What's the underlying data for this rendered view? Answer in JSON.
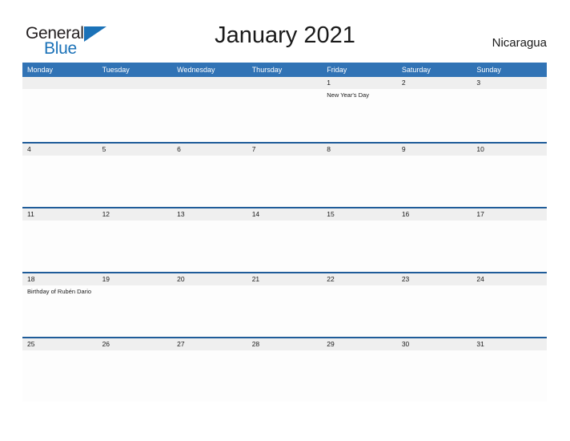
{
  "logo": {
    "text_primary": "General",
    "text_secondary": "Blue",
    "flag_icon": "triangle-flag-icon",
    "primary_color": "#231f20",
    "secondary_color": "#1b72b8"
  },
  "header": {
    "title": "January 2021",
    "country": "Nicaragua"
  },
  "colors": {
    "header_blue": "#3173b5",
    "rule_blue": "#1f5c99",
    "band_gray": "#efefef",
    "cell_white": "#fdfdfd",
    "text": "#1a1a1a"
  },
  "calendar": {
    "weekdays": [
      "Monday",
      "Tuesday",
      "Wednesday",
      "Thursday",
      "Friday",
      "Saturday",
      "Sunday"
    ],
    "weeks": [
      {
        "days": [
          {
            "date": "",
            "event": ""
          },
          {
            "date": "",
            "event": ""
          },
          {
            "date": "",
            "event": ""
          },
          {
            "date": "",
            "event": ""
          },
          {
            "date": "1",
            "event": "New Year's Day"
          },
          {
            "date": "2",
            "event": ""
          },
          {
            "date": "3",
            "event": ""
          }
        ]
      },
      {
        "days": [
          {
            "date": "4",
            "event": ""
          },
          {
            "date": "5",
            "event": ""
          },
          {
            "date": "6",
            "event": ""
          },
          {
            "date": "7",
            "event": ""
          },
          {
            "date": "8",
            "event": ""
          },
          {
            "date": "9",
            "event": ""
          },
          {
            "date": "10",
            "event": ""
          }
        ]
      },
      {
        "days": [
          {
            "date": "11",
            "event": ""
          },
          {
            "date": "12",
            "event": ""
          },
          {
            "date": "13",
            "event": ""
          },
          {
            "date": "14",
            "event": ""
          },
          {
            "date": "15",
            "event": ""
          },
          {
            "date": "16",
            "event": ""
          },
          {
            "date": "17",
            "event": ""
          }
        ]
      },
      {
        "days": [
          {
            "date": "18",
            "event": "Birthday of Rubén Dario"
          },
          {
            "date": "19",
            "event": ""
          },
          {
            "date": "20",
            "event": ""
          },
          {
            "date": "21",
            "event": ""
          },
          {
            "date": "22",
            "event": ""
          },
          {
            "date": "23",
            "event": ""
          },
          {
            "date": "24",
            "event": ""
          }
        ]
      },
      {
        "days": [
          {
            "date": "25",
            "event": ""
          },
          {
            "date": "26",
            "event": ""
          },
          {
            "date": "27",
            "event": ""
          },
          {
            "date": "28",
            "event": ""
          },
          {
            "date": "29",
            "event": ""
          },
          {
            "date": "30",
            "event": ""
          },
          {
            "date": "31",
            "event": ""
          }
        ]
      }
    ]
  }
}
